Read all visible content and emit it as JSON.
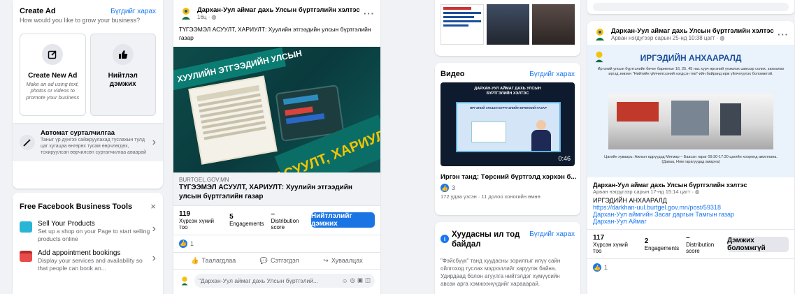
{
  "create_ad": {
    "title": "Create Ad",
    "see_all": "Бүгдийг харах",
    "subtitle": "How would you like to grow your business?",
    "option1_title": "Create New Ad",
    "option1_desc": "Make an ad using text, photos or videos to promote your business",
    "option2_title": "Нийтлэл дэмжих",
    "auto_title": "Автомат сурталчилгаа",
    "auto_desc": "Таныг үр дүнгээ сайжруулахад туслахын тулд цаг хугацаа өнгөрөх тусам өөрчлөгдөх, тохируулсан өөрчилсөн сурталчилгаа аваарай"
  },
  "tools": {
    "title": "Free Facebook Business Tools",
    "items": [
      {
        "title": "Sell Your Products",
        "desc": "Set up a shop on your Page to start selling products online"
      },
      {
        "title": "Add appointment bookings",
        "desc": "Display your services and availability so that people can book an..."
      }
    ]
  },
  "post1": {
    "page_name": "Дархан-Уул аймаг дахь Улсын бүртгэлийн хэлтэс",
    "time": "16ц ·",
    "text": "ТҮГЭЭМЭЛ АСУУЛТ, ХАРИУЛТ: Хуулийн этгээдийн улсын бүртгэлийн газар",
    "image_banner": "ХУУЛИЙН ЭТГЭЭДИЙН УЛСЫН",
    "image_headline": "АСУУЛТ, ХАРИУЛТ",
    "link_domain": "BURTGEL.GOV.MN",
    "link_title": "ТҮГЭЭМЭЛ АСУУЛТ, ХАРИУЛТ: Хуулийн этгээдийн улсын бүртгэлийн газар",
    "stats": [
      {
        "value": "119",
        "label": "Хүрсэн хүний тоо"
      },
      {
        "value": "5",
        "label": "Engagements"
      },
      {
        "value": "–",
        "label": "Distribution score"
      }
    ],
    "boost_label": "Нийтлэлийг дэмжих",
    "reactions": "1",
    "actions": [
      "Таалагдлаа",
      "Сэтгэгдэл",
      "Хуваалцах"
    ],
    "comment_placeholder": "\"Дархан-Уул аймаг дахь Улсын бүртгэлий..."
  },
  "video": {
    "title": "Видео",
    "see_all": "Бүгдийг харах",
    "duration": "0:46",
    "thumb_title": "ДАРХАН-УУЛ АЙМАГ ДАХЬ УЛСЫН БҮРТГЭЛИЙН ХЭЛТЭС",
    "thumb_subtitle": "ИРГЭНИЙ УЛСЫН БҮРТГЭЛИЙН ЕРӨНХИЙ ГАЗАР",
    "caption": "Иргэн танд: Төрсний бүртгэлд хэрхэн б...",
    "reactions": "3",
    "views": "172 удаа үзсэн · 11 долоо хоногийн өмнө"
  },
  "transparency": {
    "title": "Хуудасны ил тод байдал",
    "see_all": "Бүгдийг харах",
    "text": "\"Фэйсбүүк\" танд хуудасны зорилгыг илүү сайн ойлгоход туслах мэдээллийг харуулж байна. Удирдаад болон агуулга нийтэлдэг хүмүүсийн авсан арга хэмжээнүүдийг харааарай."
  },
  "post2": {
    "page_name": "Дархан-Уул аймаг дахь Улсын бүртгэлийн хэлтэс",
    "time": "Арван нэгдүгээр сарын 25-нд 10:38 цагт ·",
    "image_title": "ИРГЭДИЙН АНХААРАЛД",
    "image_text": "Иргэний улсын бүртгэлийн бичиг баримтыг 16, 25, 45 нас хүрч иргэний үнэмлэх шинээр солих, захиалах иргэд зөвхөн \"Нийтийн үйлчилгээний нэгдсэн төв\"-ийн байранд ирж үйлчлүүлэх боломжтой.",
    "image_hours": "Цагийн хуваарь: Ажлын өдрүүдэд Мягмар – Баасан гараг 09:30-17:30 цагийн хооронд ажиллана. (Даваа, Ням гарагуудад амарна)",
    "shared_name": "Дархан-Уул аймаг дахь Улсын бүртгэлийн хэлтэс",
    "shared_time": "Арван нэгдүгээр сарын 17-нд 15:14 цагт ·",
    "shared_title": "ИРГЭДИЙН АНХААРАЛД",
    "shared_link": "https://darkhan-uul.burtgel.gov.mn/post/59318",
    "shared_links": [
      "Дархан-Уул аймгийн Засаг даргын Тамгын газар",
      "Дархан-Уул Аймаг"
    ],
    "stats": [
      {
        "value": "117",
        "label": "Хүрсэн хүний тоо"
      },
      {
        "value": "2",
        "label": "Engagements"
      },
      {
        "value": "–",
        "label": "Distribution score"
      }
    ],
    "boost_label": "Дэмжих боломжгүй",
    "reactions": "1"
  },
  "colors": {
    "accent": "#1877f2",
    "bg": "#f0f2f5"
  }
}
